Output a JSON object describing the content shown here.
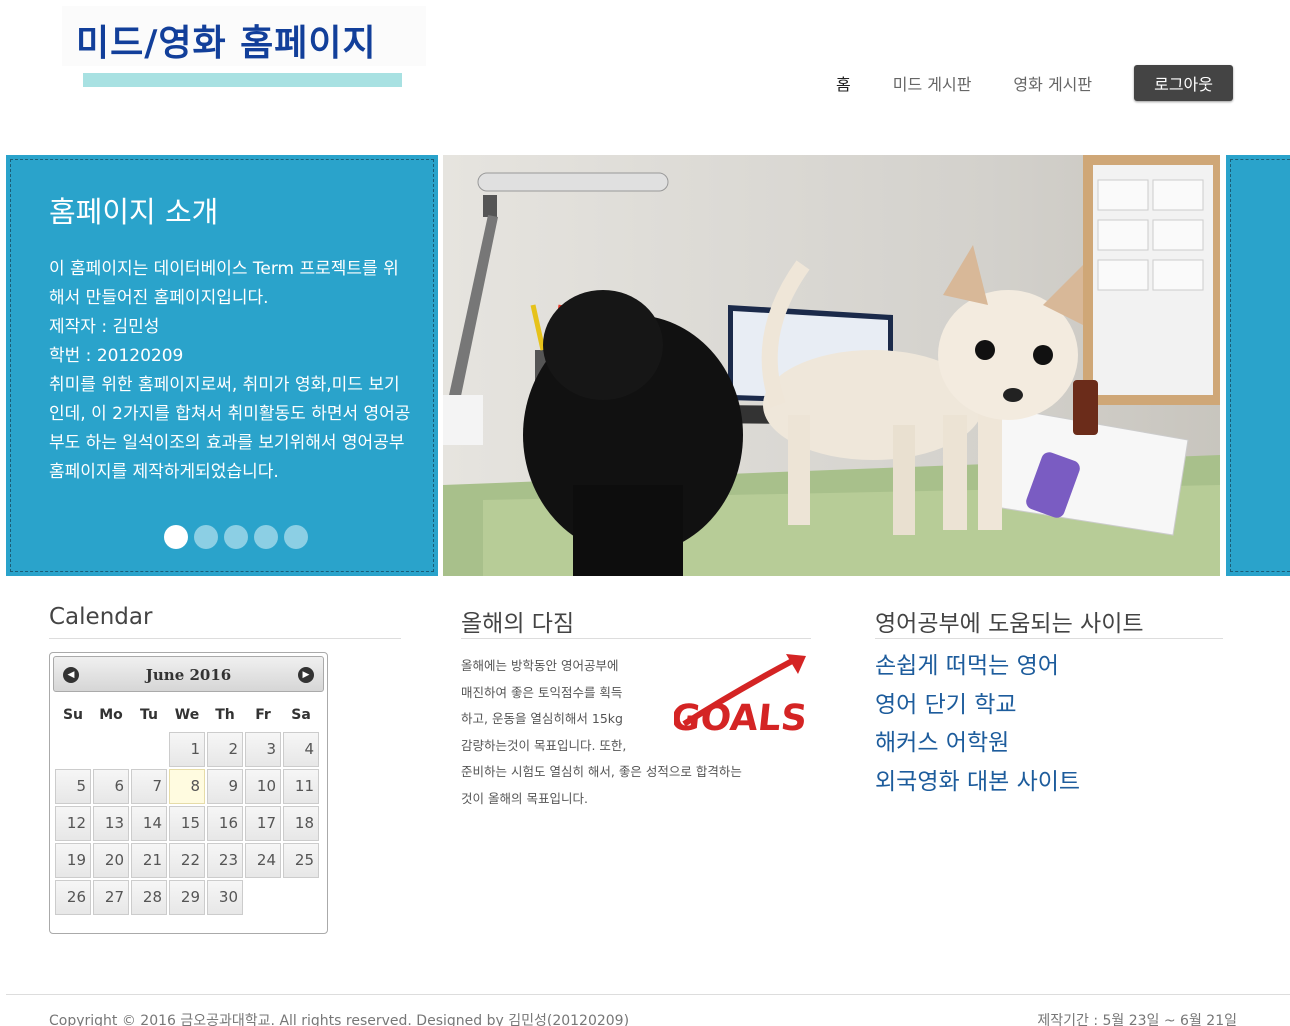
{
  "header": {
    "logo_title": "미드/영화 홈페이지",
    "nav": {
      "home": "홈",
      "drama_board": "미드 게시판",
      "movie_board": "영화 게시판",
      "logout": "로그아웃"
    }
  },
  "banner": {
    "title": "홈페이지 소개",
    "paragraphs": [
      "이 홈페이지는 데이터베이스 Term 프로젝트를 위해서 만들어진 홈페이지입니다.",
      "제작자 : 김민성",
      "학번 : 20120209",
      "취미를 위한 홈페이지로써, 취미가 영화,미드 보기 인데, 이 2가지를 합쳐서 취미활동도 하면서 영어공부도 하는 일석이조의 효과를 보기위해서 영어공부 홈페이지를 제작하게되었습니다."
    ],
    "slide_count": 5,
    "active_slide": 0,
    "accent_color": "#2aa3cb"
  },
  "calendar": {
    "section_title": "Calendar",
    "month_label": "June 2016",
    "prev_icon": "prev-circle-icon",
    "next_icon": "next-circle-icon",
    "weekdays": [
      "Su",
      "Mo",
      "Tu",
      "We",
      "Th",
      "Fr",
      "Sa"
    ],
    "weeks": [
      [
        "",
        "",
        "",
        "1",
        "2",
        "3",
        "4"
      ],
      [
        "5",
        "6",
        "7",
        "8",
        "9",
        "10",
        "11"
      ],
      [
        "12",
        "13",
        "14",
        "15",
        "16",
        "17",
        "18"
      ],
      [
        "19",
        "20",
        "21",
        "22",
        "23",
        "24",
        "25"
      ],
      [
        "26",
        "27",
        "28",
        "29",
        "30",
        "",
        ""
      ]
    ],
    "today": "8"
  },
  "resolution": {
    "section_title": "올해의 다짐",
    "lines": [
      "올해에는 방학동안 영어공부에",
      "매진하여 좋은 토익점수를 획득",
      "하고, 운동을 열심히해서 15kg",
      "감량하는것이 목표입니다. 또한,",
      "준비하는 시험도 열심히 해서, 좋은 성적으로 합격하는",
      "것이 올해의 목표입니다."
    ],
    "image_word": "GOALS"
  },
  "links": {
    "section_title": "영어공부에 도움되는 사이트",
    "items": [
      "손쉽게 떠먹는 영어",
      "영어 단기 학교",
      "해커스 어학원",
      "외국영화 대본 사이트"
    ]
  },
  "footer": {
    "copyright": "Copyright © 2016 금오공과대학교. All rights reserved. Designed by 김민성(20120209)",
    "period": "제작기간 : 5월 23일 ~ 6월 21일"
  }
}
